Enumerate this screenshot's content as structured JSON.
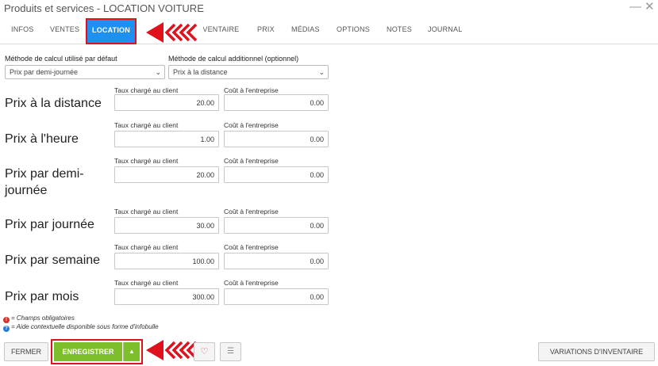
{
  "window": {
    "title": "Produits et services - LOCATION VOITURE",
    "minimize_icon": "—",
    "close_icon": "✕"
  },
  "tabs": [
    {
      "label": "INFOS",
      "active": false
    },
    {
      "label": "VENTES",
      "active": false
    },
    {
      "label": "LOCATION",
      "active": true
    },
    {
      "label": "INVENTAIRE",
      "active": false
    },
    {
      "label": "PRIX",
      "active": false
    },
    {
      "label": "MÉDIAS",
      "active": false
    },
    {
      "label": "OPTIONS",
      "active": false
    },
    {
      "label": "NOTES",
      "active": false
    },
    {
      "label": "JOURNAL",
      "active": false
    }
  ],
  "calc": {
    "default_label": "Méthode de calcul utilisé par défaut",
    "default_value": "Prix par demi-journée",
    "additional_label": "Méthode de calcul additionnel (optionnel)",
    "additional_value": "Prix à la distance"
  },
  "columns": {
    "client": "Taux chargé au client",
    "company": "Coût à l'entreprise"
  },
  "rows": [
    {
      "title": "Prix à la distance",
      "client": "20.00",
      "company": "0.00"
    },
    {
      "title": "Prix à l'heure",
      "client": "1.00",
      "company": "0.00"
    },
    {
      "title": "Prix par demi-journée",
      "client": "20.00",
      "company": "0.00"
    },
    {
      "title": "Prix par journée",
      "client": "30.00",
      "company": "0.00"
    },
    {
      "title": "Prix par semaine",
      "client": "100.00",
      "company": "0.00"
    },
    {
      "title": "Prix par mois",
      "client": "300.00",
      "company": "0.00"
    }
  ],
  "legend": {
    "required": "= Champs obligatoires",
    "help": "= Aide contextuelle disponible sous forme d'infobulle"
  },
  "footer": {
    "close_label": "FERMER",
    "save_label": "ENREGISTRER",
    "variations_label": "VARIATIONS D'INVENTAIRE"
  },
  "colors": {
    "active_tab": "#1e90f0",
    "save_button": "#7dbf2a",
    "annotation_red": "#e0101c",
    "required_dot": "#d9302c",
    "help_dot": "#2b7bd6"
  }
}
